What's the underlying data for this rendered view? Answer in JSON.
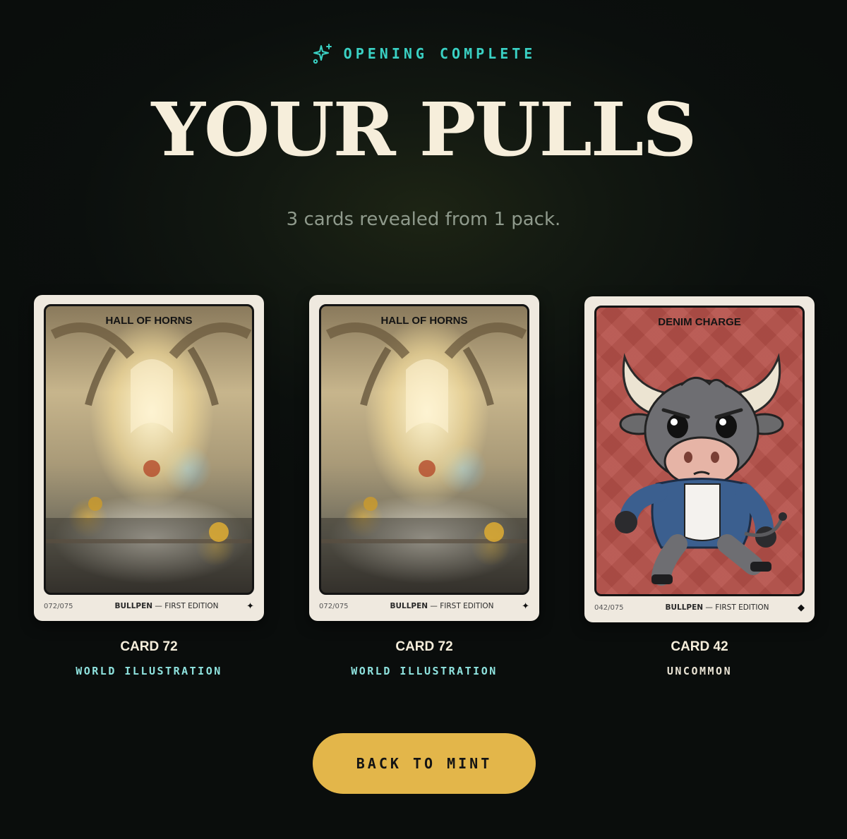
{
  "header": {
    "eyebrow_icon": "sparkles-icon",
    "eyebrow": "OPENING COMPLETE",
    "title": "YOUR PULLS",
    "subtitle": "3 cards revealed from 1 pack."
  },
  "colors": {
    "accent_teal": "#3ad1c4",
    "title_cream": "#f6eedb",
    "button_gold": "#e3b64a",
    "rarity_world": "#8fe3df",
    "rarity_uncommon": "#e9e3d4",
    "card_frame": "#efe9df",
    "denim_bg": "#b55049"
  },
  "cards": [
    {
      "art_title": "HALL OF HORNS",
      "serial": "072/075",
      "set_name": "BULLPEN",
      "set_separator": "—",
      "edition": "FIRST EDITION",
      "mark_icon": "four-point-star-icon",
      "name": "CARD 72",
      "rarity": "WORLD ILLUSTRATION"
    },
    {
      "art_title": "HALL OF HORNS",
      "serial": "072/075",
      "set_name": "BULLPEN",
      "set_separator": "—",
      "edition": "FIRST EDITION",
      "mark_icon": "four-point-star-icon",
      "name": "CARD 72",
      "rarity": "WORLD ILLUSTRATION"
    },
    {
      "art_title": "DENIM CHARGE",
      "serial": "042/075",
      "set_name": "BULLPEN",
      "set_separator": "—",
      "edition": "FIRST EDITION",
      "mark_icon": "diamond-icon",
      "name": "CARD 42",
      "rarity": "UNCOMMON"
    }
  ],
  "actions": {
    "back_label": "BACK TO MINT"
  }
}
